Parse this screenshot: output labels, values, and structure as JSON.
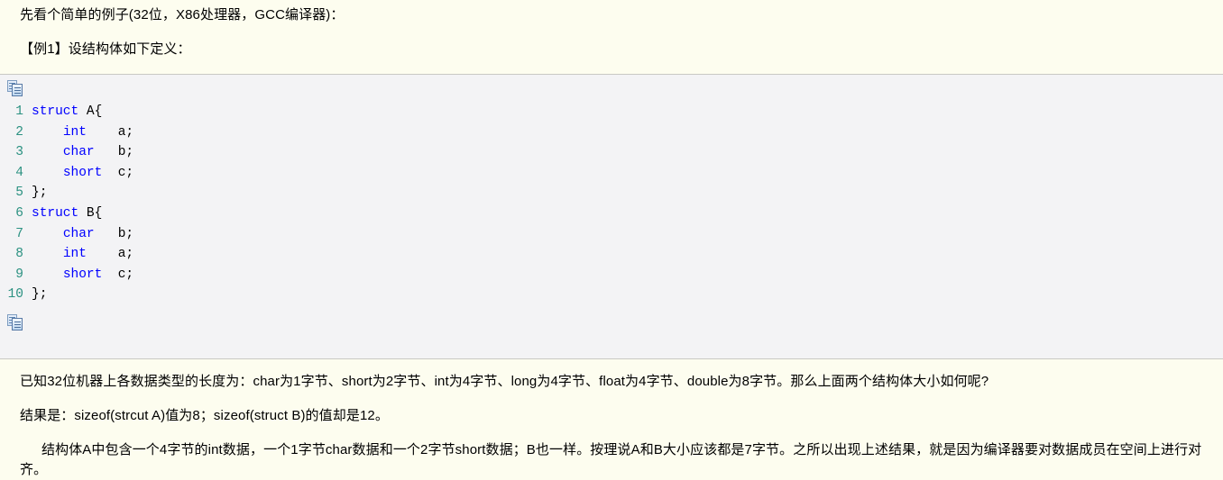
{
  "page": {
    "background_color": "#fdfdef",
    "code_background_color": "#f3f3f5",
    "code_border_color": "#c9c9c4",
    "linenumber_color": "#2b9181",
    "keyword_color": "#0000ff"
  },
  "intro": {
    "paragraph_1": "先看个简单的例子(32位，X86处理器，GCC编译器)：",
    "paragraph_2": "【例1】设结构体如下定义："
  },
  "code_block": {
    "copy_icon_top_title": "复制代码",
    "copy_icon_bottom_title": "复制代码",
    "lines": [
      {
        "number": "1",
        "indent": "",
        "keyword": "struct",
        "rest": " A{"
      },
      {
        "number": "2",
        "indent": "    ",
        "keyword": "int",
        "rest": "    a;"
      },
      {
        "number": "3",
        "indent": "    ",
        "keyword": "char",
        "rest": "   b;"
      },
      {
        "number": "4",
        "indent": "    ",
        "keyword": "short",
        "rest": "  c;"
      },
      {
        "number": "5",
        "indent": "",
        "keyword": "",
        "rest": "};"
      },
      {
        "number": "6",
        "indent": "",
        "keyword": "struct",
        "rest": " B{"
      },
      {
        "number": "7",
        "indent": "    ",
        "keyword": "char",
        "rest": "   b;"
      },
      {
        "number": "8",
        "indent": "    ",
        "keyword": "int",
        "rest": "    a;"
      },
      {
        "number": "9",
        "indent": "    ",
        "keyword": "short",
        "rest": "  c;"
      },
      {
        "number": "10",
        "indent": "",
        "keyword": "",
        "rest": "};"
      }
    ]
  },
  "explanation": {
    "paragraph_3": "已知32位机器上各数据类型的长度为：char为1字节、short为2字节、int为4字节、long为4字节、float为4字节、double为8字节。那么上面两个结构体大小如何呢?",
    "paragraph_4": "结果是：sizeof(strcut A)值为8；sizeof(struct B)的值却是12。",
    "paragraph_5": "结构体A中包含一个4字节的int数据，一个1字节char数据和一个2字节short数据；B也一样。按理说A和B大小应该都是7字节。之所以出现上述结果，就是因为编译器要对数据成员在空间上进行对齐。"
  }
}
